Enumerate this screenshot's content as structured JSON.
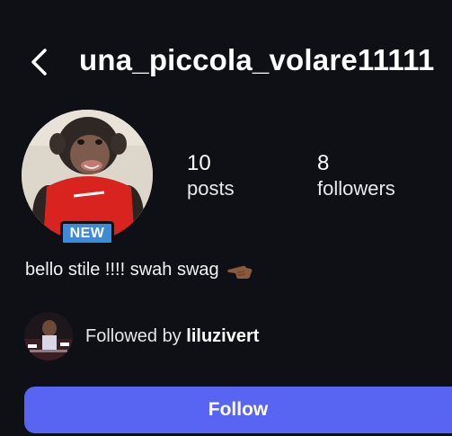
{
  "header": {
    "back_icon": "chevron-left-icon",
    "username": "una_piccola_volare11111"
  },
  "profile": {
    "avatar_icon": "chimp-in-red-shirt-photo",
    "badge": "NEW",
    "stats": [
      {
        "value": "10",
        "label": "posts"
      },
      {
        "value": "8",
        "label": "followers"
      }
    ],
    "bio": "bello stile !!!! swah swag",
    "bio_emoji": "pointing-hand-emoji"
  },
  "followed_by": {
    "prefix": "Followed by",
    "name": "liluzivert"
  },
  "actions": {
    "follow_label": "Follow"
  },
  "colors": {
    "background": "#0e1015",
    "badge": "#3d8bd6",
    "follow_button": "#5865f2",
    "text": "#ffffff"
  }
}
